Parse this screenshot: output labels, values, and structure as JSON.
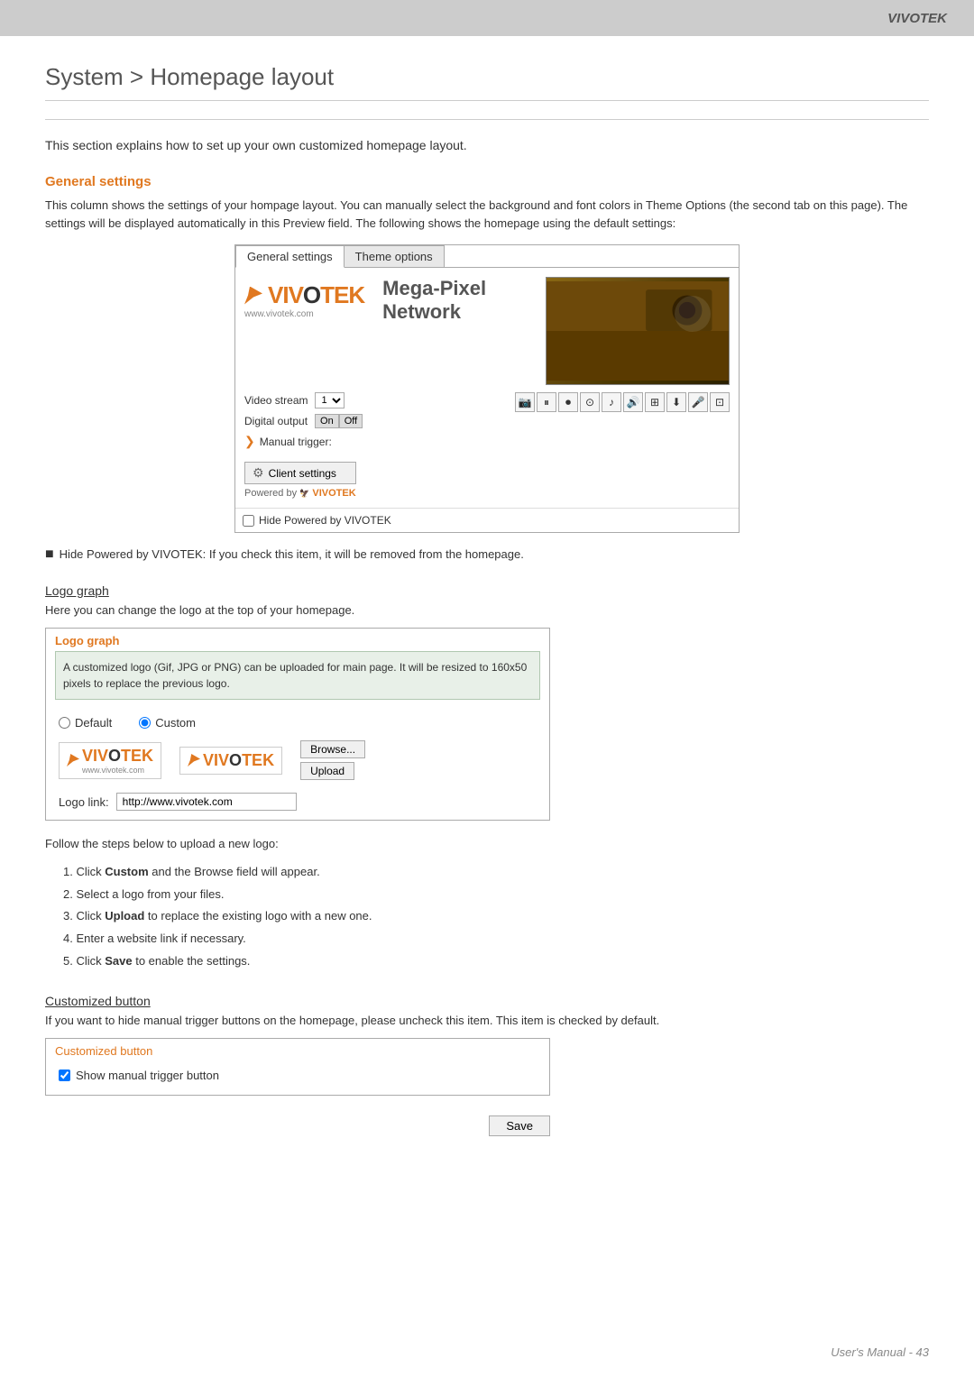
{
  "brand": "VIVOTEK",
  "page": {
    "title": "System > Homepage layout",
    "intro": "This section explains how to set up your own customized homepage layout."
  },
  "general_settings": {
    "heading": "General settings",
    "description": "This column shows the settings of your hompage layout. You can manually select the background and font colors in Theme Options (the second tab on this page). The settings will be displayed automatically in this Preview field. The following shows the homepage using the default settings:",
    "tabs": {
      "tab1": "General settings",
      "tab2": "Theme options"
    },
    "preview": {
      "logo_text": "VIVOTEK",
      "logo_url": "www.vivotek.com",
      "mega_pixel": "Mega-Pixel Network",
      "video_stream_label": "Video stream",
      "video_stream_value": "1",
      "digital_output_label": "Digital output",
      "btn_on": "On",
      "btn_off": "Off",
      "manual_trigger": "Manual trigger:",
      "client_settings": "Client settings",
      "powered_by": "Powered by",
      "powered_brand": "VIVOTEK"
    },
    "hide_powered_label": "Hide Powered by VIVOTEK",
    "note": "Hide Powered by VIVOTEK: If you check this item, it will be removed from the homepage."
  },
  "logo_graph": {
    "heading": "Logo graph",
    "desc": "Here you can change the logo at the top of your homepage.",
    "panel_title": "Logo graph",
    "info_text": "A customized logo (Gif, JPG or PNG) can be uploaded for main page. It will be resized to 160x50 pixels to replace the previous logo.",
    "default_label": "Default",
    "custom_label": "Custom",
    "logo_url_label": "Logo link:",
    "logo_url_value": "http://www.vivotek.com",
    "browse_btn": "Browse...",
    "upload_btn": "Upload"
  },
  "steps": {
    "intro": "Follow the steps below to upload a new logo:",
    "items": [
      "1. Click Custom and the Browse field will appear.",
      "2. Select a logo from your files.",
      "3. Click Upload to replace the existing logo with a new one.",
      "4. Enter a website link if necessary.",
      "5. Click Save to enable the settings."
    ],
    "bold_words": [
      "Custom",
      "Upload",
      "Save"
    ]
  },
  "customized_button": {
    "heading": "Customized button",
    "desc": "If you want to hide manual trigger buttons on the homepage, please uncheck this item. This item is checked by default.",
    "panel_title": "Customized button",
    "checkbox_label": "Show manual trigger button",
    "save_btn": "Save"
  },
  "footer": {
    "text": "User's Manual - 43"
  }
}
